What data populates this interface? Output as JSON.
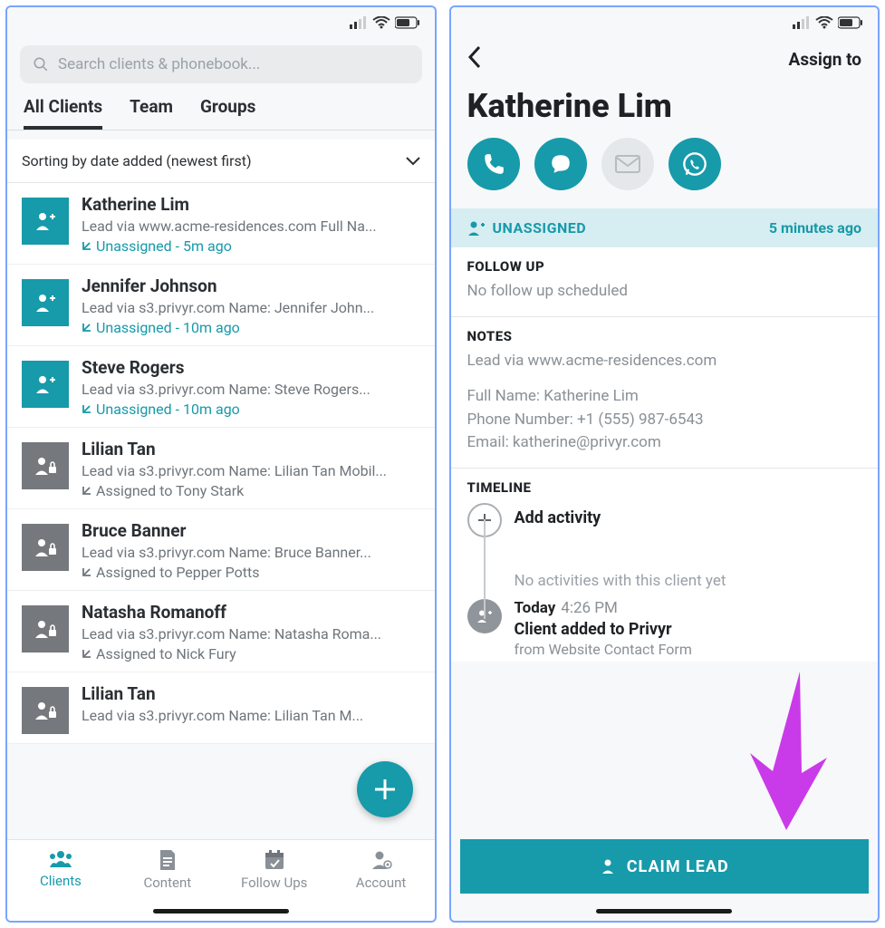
{
  "left": {
    "search_placeholder": "Search clients & phonebook...",
    "tabs": [
      "All Clients",
      "Team",
      "Groups"
    ],
    "sort_label": "Sorting by date added (newest first)",
    "clients": [
      {
        "name": "Katherine Lim",
        "sub": "Lead via www.acme-residences.com  Full Na...",
        "meta": "Unassigned - 5m ago",
        "unassigned": true
      },
      {
        "name": "Jennifer Johnson",
        "sub": "Lead via s3.privyr.com  Name: Jennifer John...",
        "meta": "Unassigned - 10m ago",
        "unassigned": true
      },
      {
        "name": "Steve Rogers",
        "sub": "Lead via s3.privyr.com  Name: Steve Rogers...",
        "meta": "Unassigned - 10m ago",
        "unassigned": true
      },
      {
        "name": "Lilian Tan",
        "sub": "Lead via s3.privyr.com  Name: Lilian Tan Mobil...",
        "meta": "Assigned to Tony Stark",
        "unassigned": false
      },
      {
        "name": "Bruce Banner",
        "sub": "Lead via s3.privyr.com  Name: Bruce Banner...",
        "meta": "Assigned to Pepper Potts",
        "unassigned": false
      },
      {
        "name": "Natasha Romanoff",
        "sub": "Lead via s3.privyr.com  Name: Natasha Roma...",
        "meta": "Assigned to Nick Fury",
        "unassigned": false
      },
      {
        "name": "Lilian Tan",
        "sub": "Lead via s3.privyr.com  Name: Lilian Tan M...",
        "meta": "",
        "unassigned": false
      }
    ],
    "nav": [
      "Clients",
      "Content",
      "Follow Ups",
      "Account"
    ]
  },
  "right": {
    "assign_label": "Assign to",
    "client_name": "Katherine Lim",
    "status": {
      "label": "UNASSIGNED",
      "time": "5 minutes ago"
    },
    "followup": {
      "title": "FOLLOW UP",
      "body": "No follow up scheduled"
    },
    "notes": {
      "title": "NOTES",
      "line1": "Lead via www.acme-residences.com",
      "line2": "Full Name: Katherine Lim",
      "line3": "Phone Number: +1 (555) 987-6543",
      "line4": "Email: katherine@privyr.com"
    },
    "timeline": {
      "title": "TIMELINE",
      "add": "Add activity",
      "empty": "No activities with this client yet",
      "today_label": "Today",
      "today_time": "4:26 PM",
      "event_title": "Client added to Privyr",
      "event_sub": "from Website Contact Form"
    },
    "claim_label": "CLAIM LEAD"
  }
}
